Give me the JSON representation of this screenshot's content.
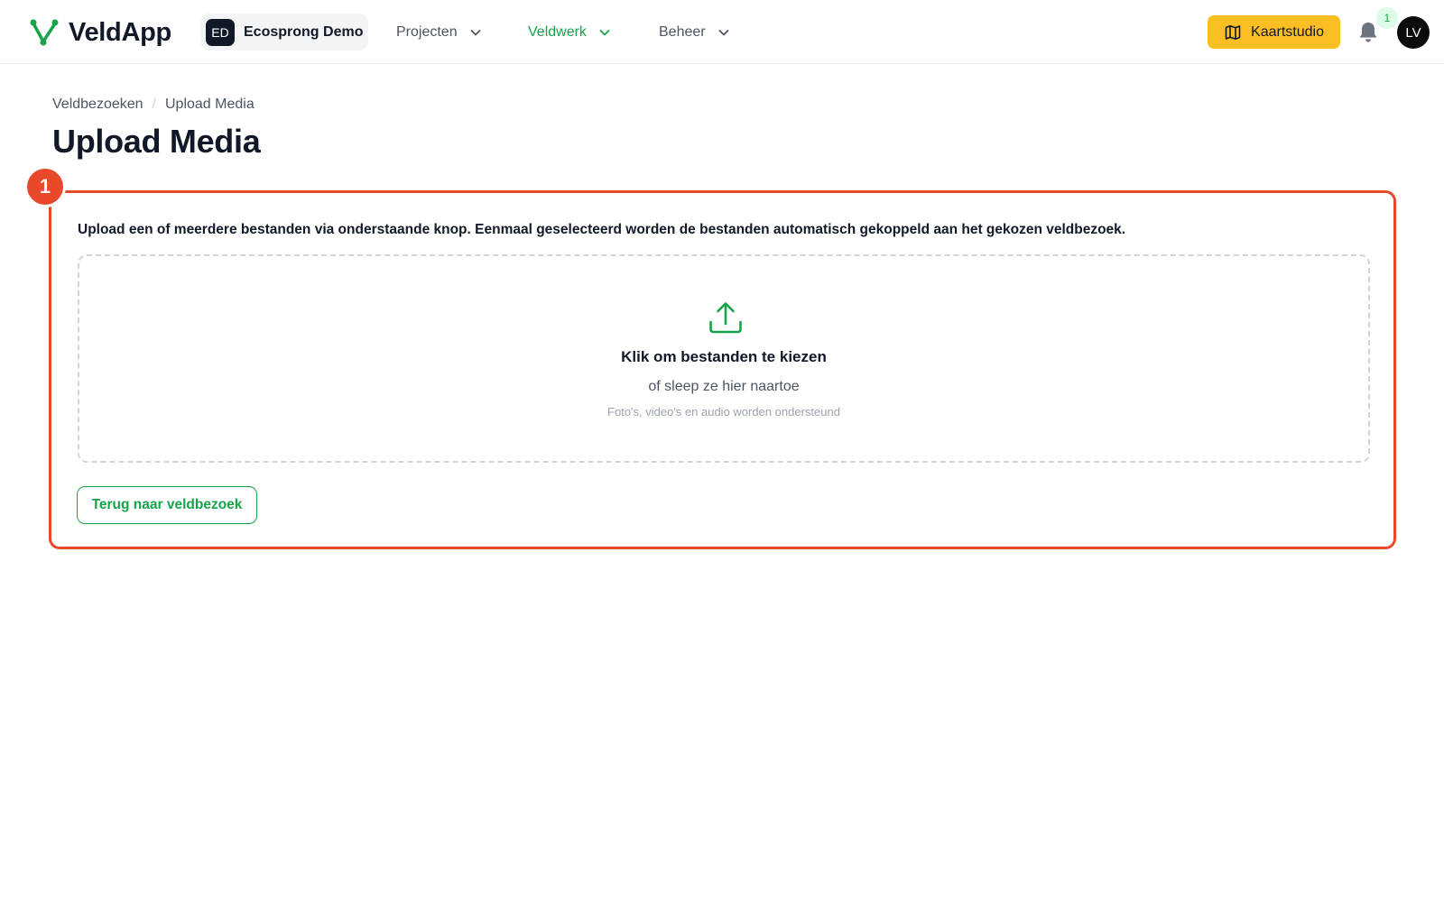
{
  "app": {
    "name": "VeldApp"
  },
  "org": {
    "initials": "ED",
    "name": "Ecosprong Demo"
  },
  "nav": [
    {
      "label": "Projecten",
      "active": false
    },
    {
      "label": "Veldwerk",
      "active": true
    },
    {
      "label": "Beheer",
      "active": false
    }
  ],
  "header": {
    "studio_label": "Kaartstudio",
    "notification_count": "1",
    "user_initials": "LV"
  },
  "breadcrumb": {
    "parent": "Veldbezoeken",
    "separator": "/",
    "current": "Upload Media"
  },
  "page": {
    "title": "Upload Media"
  },
  "annotation": {
    "step": "1"
  },
  "upload": {
    "instruction": "Upload een of meerdere bestanden via onderstaande knop. Eenmaal geselecteerd worden de bestanden automatisch gekoppeld aan het gekozen veldbezoek.",
    "title": "Klik om bestanden te kiezen",
    "subtitle": "of sleep ze hier naartoe",
    "hint": "Foto's, video's en audio worden ondersteund",
    "icon": "upload-icon"
  },
  "actions": {
    "back_label": "Terug naar veldbezoek"
  },
  "colors": {
    "brand_green": "#16a34a",
    "accent_yellow": "#fbbf24",
    "highlight_red": "#e8492a"
  }
}
